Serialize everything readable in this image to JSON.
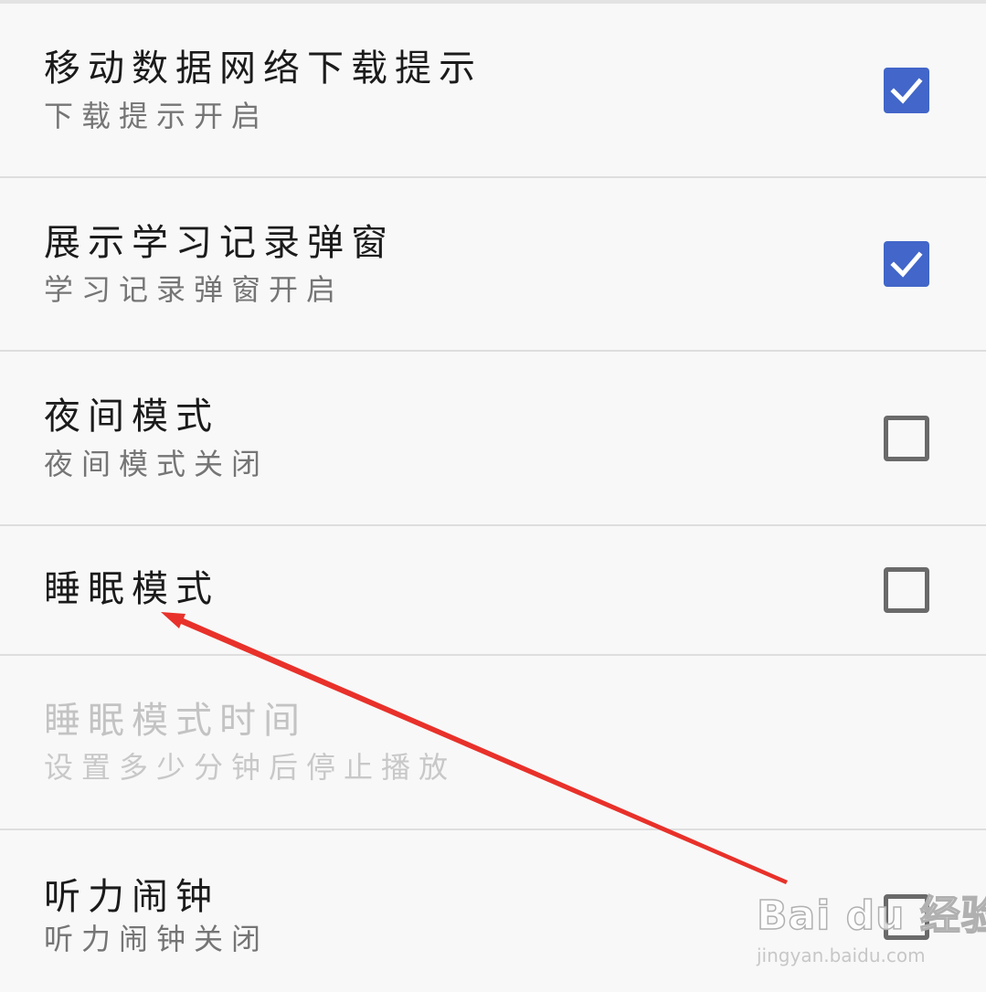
{
  "settings": [
    {
      "title": "移动数据网络下载提示",
      "summary": "下载提示开启",
      "checked": true,
      "enabled": true
    },
    {
      "title": "展示学习记录弹窗",
      "summary": "学习记录弹窗开启",
      "checked": true,
      "enabled": true
    },
    {
      "title": "夜间模式",
      "summary": "夜间模式关闭",
      "checked": false,
      "enabled": true
    },
    {
      "title": "睡眠模式",
      "summary": "",
      "checked": false,
      "enabled": true
    },
    {
      "title": "睡眠模式时间",
      "summary": "设置多少分钟后停止播放",
      "checked": null,
      "enabled": false
    },
    {
      "title": "听力闹钟",
      "summary": "听力闹钟关闭",
      "checked": false,
      "enabled": true
    }
  ],
  "colors": {
    "checkbox_on": "#4266c9",
    "checkbox_off_border": "#6a6a6a",
    "annotation_arrow": "#e8312a"
  },
  "watermark": {
    "brand": "Bai du 经验",
    "site": "jingyan.baidu.com"
  }
}
